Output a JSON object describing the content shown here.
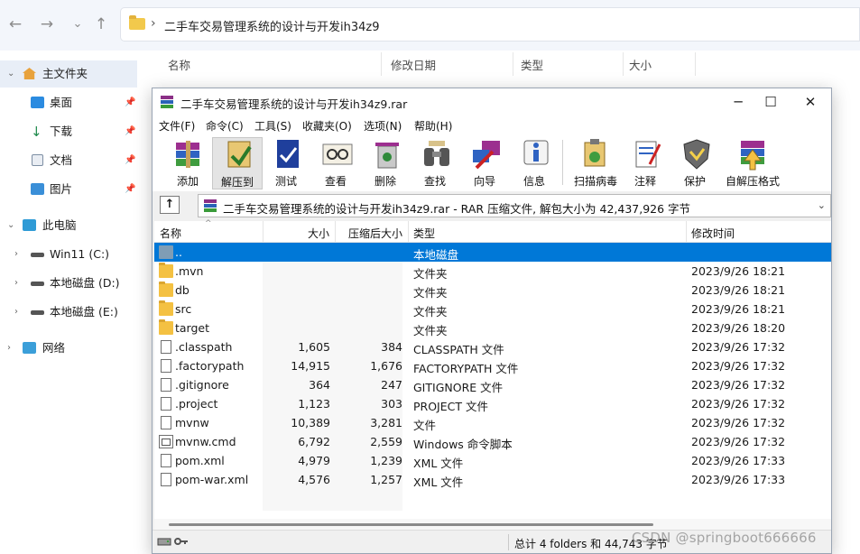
{
  "explorer": {
    "address_path": "二手车交易管理系统的设计与开发ih34z9",
    "columns": [
      "名称",
      "修改日期",
      "类型",
      "大小"
    ],
    "sidebar": {
      "home": "主文件夹",
      "quick": [
        {
          "label": "桌面"
        },
        {
          "label": "下载"
        },
        {
          "label": "文档"
        },
        {
          "label": "图片"
        }
      ],
      "this_pc": "此电脑",
      "drives": [
        {
          "label": "Win11 (C:)"
        },
        {
          "label": "本地磁盘 (D:)"
        },
        {
          "label": "本地磁盘 (E:)"
        }
      ],
      "network": "网络"
    }
  },
  "rar": {
    "title": "二手车交易管理系统的设计与开发ih34z9.rar",
    "menu": [
      "文件(F)",
      "命令(C)",
      "工具(S)",
      "收藏夹(O)",
      "选项(N)",
      "帮助(H)"
    ],
    "toolbar": [
      "添加",
      "解压到",
      "测试",
      "查看",
      "删除",
      "查找",
      "向导",
      "信息",
      "扫描病毒",
      "注释",
      "保护",
      "自解压格式"
    ],
    "path_text": "二手车交易管理系统的设计与开发ih34z9.rar - RAR 压缩文件, 解包大小为 42,437,926 字节",
    "columns": {
      "name": "名称",
      "size": "大小",
      "packed": "压缩后大小",
      "type": "类型",
      "modified": "修改时间"
    },
    "rows": [
      {
        "name": "..",
        "size": "",
        "packed": "",
        "type": "本地磁盘",
        "modified": "",
        "kind": "up"
      },
      {
        "name": ".mvn",
        "size": "",
        "packed": "",
        "type": "文件夹",
        "modified": "2023/9/26 18:21",
        "kind": "folder"
      },
      {
        "name": "db",
        "size": "",
        "packed": "",
        "type": "文件夹",
        "modified": "2023/9/26 18:21",
        "kind": "folder"
      },
      {
        "name": "src",
        "size": "",
        "packed": "",
        "type": "文件夹",
        "modified": "2023/9/26 18:21",
        "kind": "folder"
      },
      {
        "name": "target",
        "size": "",
        "packed": "",
        "type": "文件夹",
        "modified": "2023/9/26 18:20",
        "kind": "folder"
      },
      {
        "name": ".classpath",
        "size": "1,605",
        "packed": "384",
        "type": "CLASSPATH 文件",
        "modified": "2023/9/26 17:32",
        "kind": "file"
      },
      {
        "name": ".factorypath",
        "size": "14,915",
        "packed": "1,676",
        "type": "FACTORYPATH 文件",
        "modified": "2023/9/26 17:32",
        "kind": "file"
      },
      {
        "name": ".gitignore",
        "size": "364",
        "packed": "247",
        "type": "GITIGNORE 文件",
        "modified": "2023/9/26 17:32",
        "kind": "file"
      },
      {
        "name": ".project",
        "size": "1,123",
        "packed": "303",
        "type": "PROJECT 文件",
        "modified": "2023/9/26 17:32",
        "kind": "file"
      },
      {
        "name": "mvnw",
        "size": "10,389",
        "packed": "3,281",
        "type": "文件",
        "modified": "2023/9/26 17:32",
        "kind": "file"
      },
      {
        "name": "mvnw.cmd",
        "size": "6,792",
        "packed": "2,559",
        "type": "Windows 命令脚本",
        "modified": "2023/9/26 17:32",
        "kind": "cmd"
      },
      {
        "name": "pom.xml",
        "size": "4,979",
        "packed": "1,239",
        "type": "XML 文件",
        "modified": "2023/9/26 17:33",
        "kind": "file"
      },
      {
        "name": "pom-war.xml",
        "size": "4,576",
        "packed": "1,257",
        "type": "XML 文件",
        "modified": "2023/9/26 17:33",
        "kind": "file"
      }
    ],
    "status": "总计 4 folders 和 44,743 字节"
  },
  "watermark": "CSDN @springboot666666",
  "colors": {
    "selection": "#0078d7",
    "folder": "#f4c142"
  }
}
